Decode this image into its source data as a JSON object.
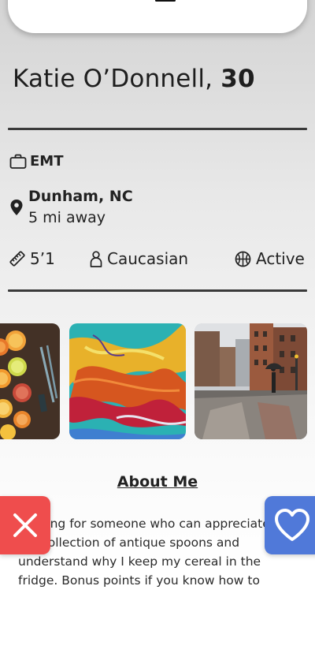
{
  "profile": {
    "name": "Katie O’Donnell,",
    "age": "30",
    "occupation": "EMT",
    "location": {
      "city": "Dunham, NC",
      "distance": "5 mi away"
    },
    "stats": {
      "height": "5’1",
      "ethnicity": "Caucasian",
      "activity": "Active"
    }
  },
  "photos": [
    {
      "subject": "sliced citrus fruit with knife"
    },
    {
      "subject": "abstract colorful fluid paint"
    },
    {
      "subject": "rainy city street with brick buildings"
    }
  ],
  "about": {
    "title": "About Me",
    "body": "Looking for someone who can appreciate my collection of antique spoons and understand why I keep my cereal in the fridge. Bonus points if you know how to"
  },
  "actions": {
    "dislike_icon": "close-icon",
    "like_icon": "heart-icon",
    "dislike_color": "#ef4d4d",
    "like_color": "#5079d9"
  },
  "icons": {
    "occupation": "briefcase-icon",
    "location": "map-pin-icon",
    "height": "ruler-icon",
    "ethnicity": "person-icon",
    "activity": "basketball-icon"
  }
}
